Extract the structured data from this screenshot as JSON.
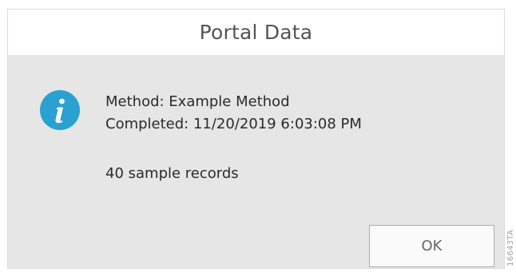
{
  "dialog": {
    "title": "Portal Data",
    "icon": "info-icon",
    "message_lines": [
      "Method: Example Method",
      "Completed: 11/20/2019 6:03:08 PM"
    ],
    "records_text": "40 sample records",
    "ok_label": "OK"
  },
  "figure_id": "16643TA",
  "colors": {
    "icon_blue": "#2aa1d0",
    "dialog_bg": "#e6e6e6",
    "title_bg": "#ffffff"
  }
}
